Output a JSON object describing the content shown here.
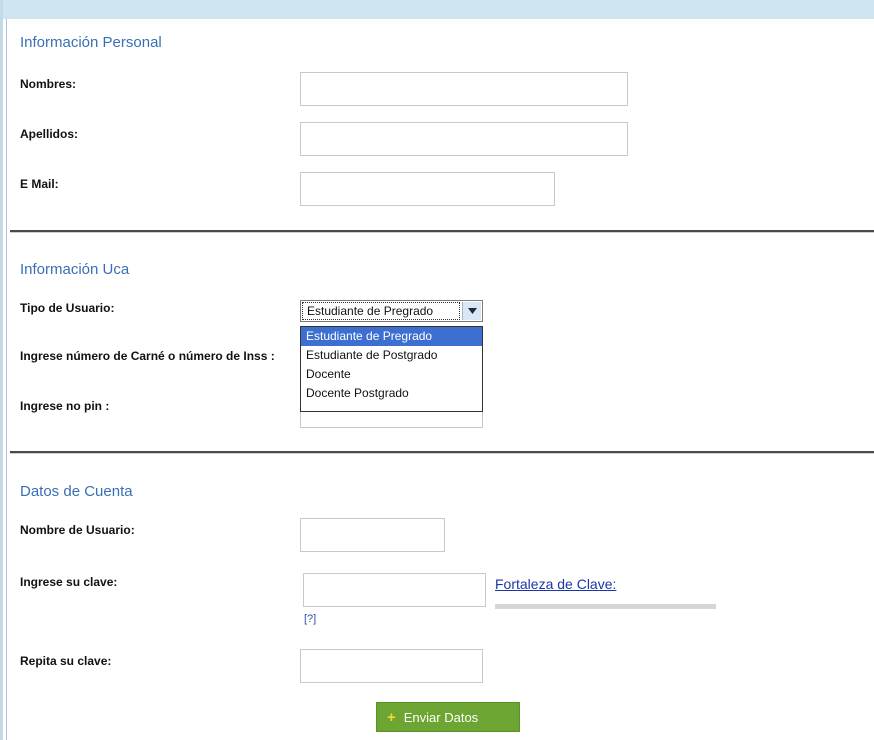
{
  "sections": {
    "personal": {
      "title": "Información Personal",
      "nombres_label": "Nombres:",
      "apellidos_label": "Apellidos:",
      "email_label": "E Mail:"
    },
    "uca": {
      "title": "Información Uca",
      "tipo_label": "Tipo de Usuario:",
      "carne_label": "Ingrese número de Carné o número de Inss :",
      "pin_label": "Ingrese no pin :",
      "tipo_selected": "Estudiante de Pregrado",
      "tipo_options": [
        "Estudiante de Pregrado",
        "Estudiante de Postgrado",
        "Docente",
        "Docente Postgrado"
      ]
    },
    "cuenta": {
      "title": "Datos de Cuenta",
      "usuario_label": "Nombre de Usuario:",
      "clave_label": "Ingrese su clave:",
      "repita_label": "Repita su clave:",
      "strength_link": "Fortaleza de Clave:",
      "help_link": "[?]"
    }
  },
  "submit_label": "Enviar Datos",
  "colors": {
    "section_title": "#3a6fb6",
    "submit_bg": "#6ca531",
    "top_bar": "#cfe6f0",
    "dropdown_highlight": "#3c6fd0"
  },
  "icons": {
    "submit": "plus-icon",
    "select": "chevron-down-icon"
  }
}
